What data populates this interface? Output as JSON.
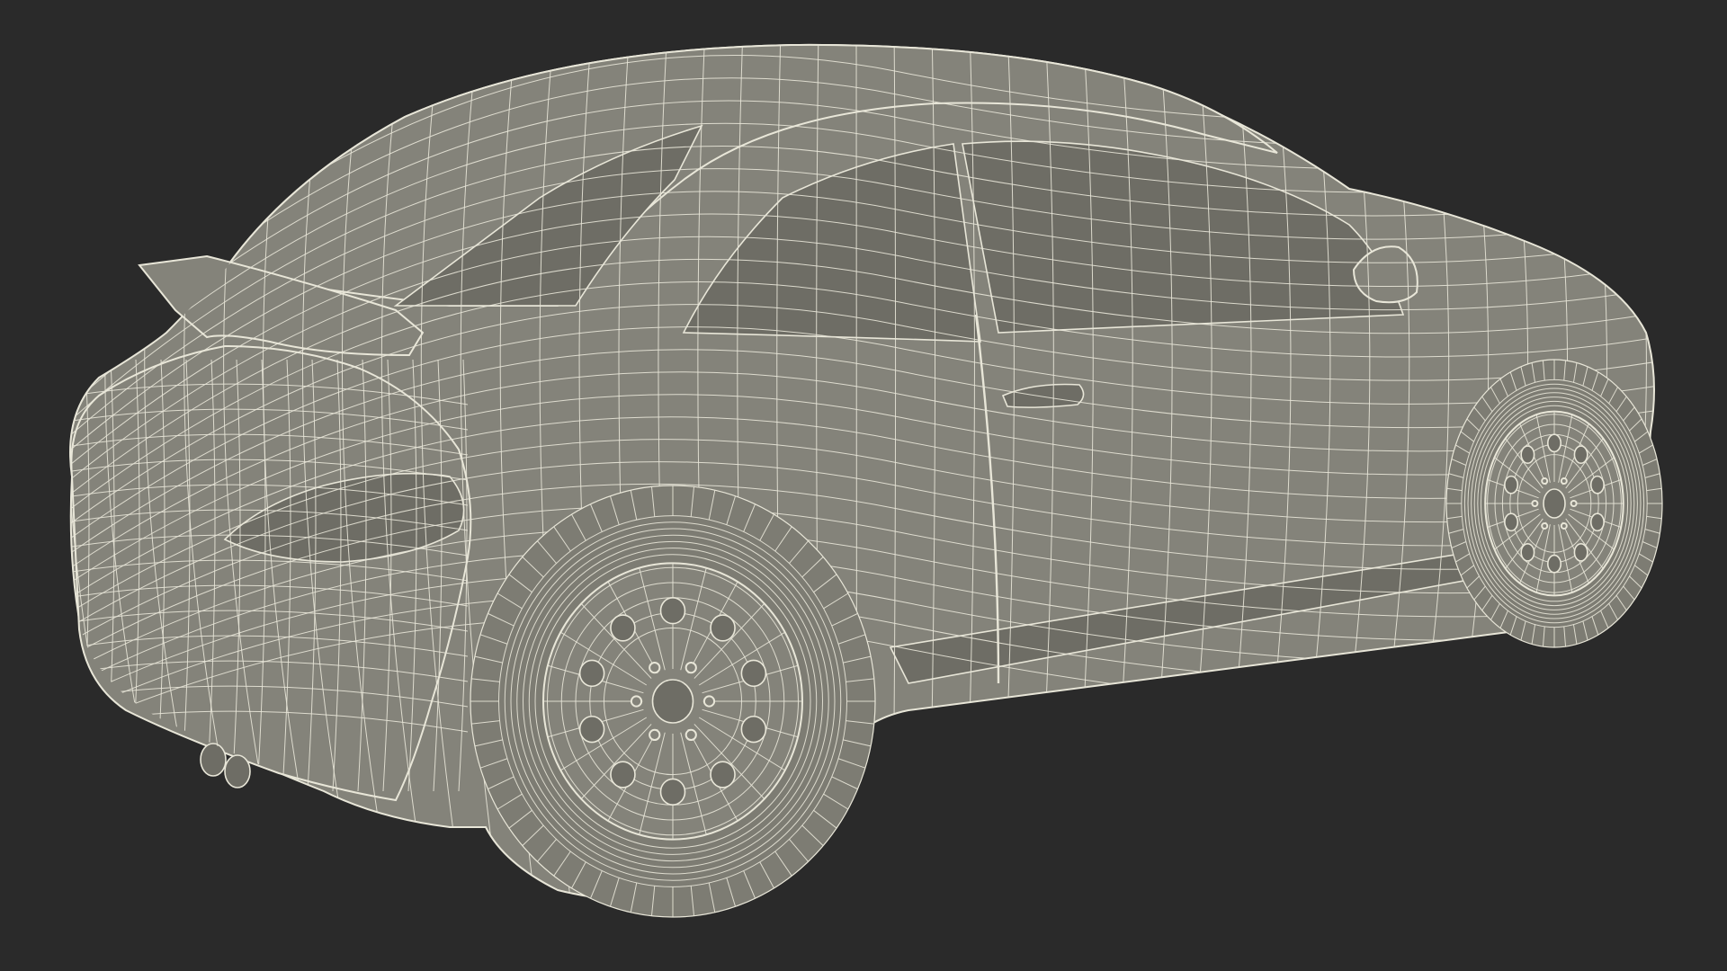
{
  "scene": {
    "background_color": "#2a2a2a",
    "surface_color": "#84837a",
    "surface_dark_color": "#6e6d65",
    "wire_color": "#e8e6d8",
    "tire_color": "#7d7c73",
    "subject_icon": "wireframe-car-icon"
  }
}
